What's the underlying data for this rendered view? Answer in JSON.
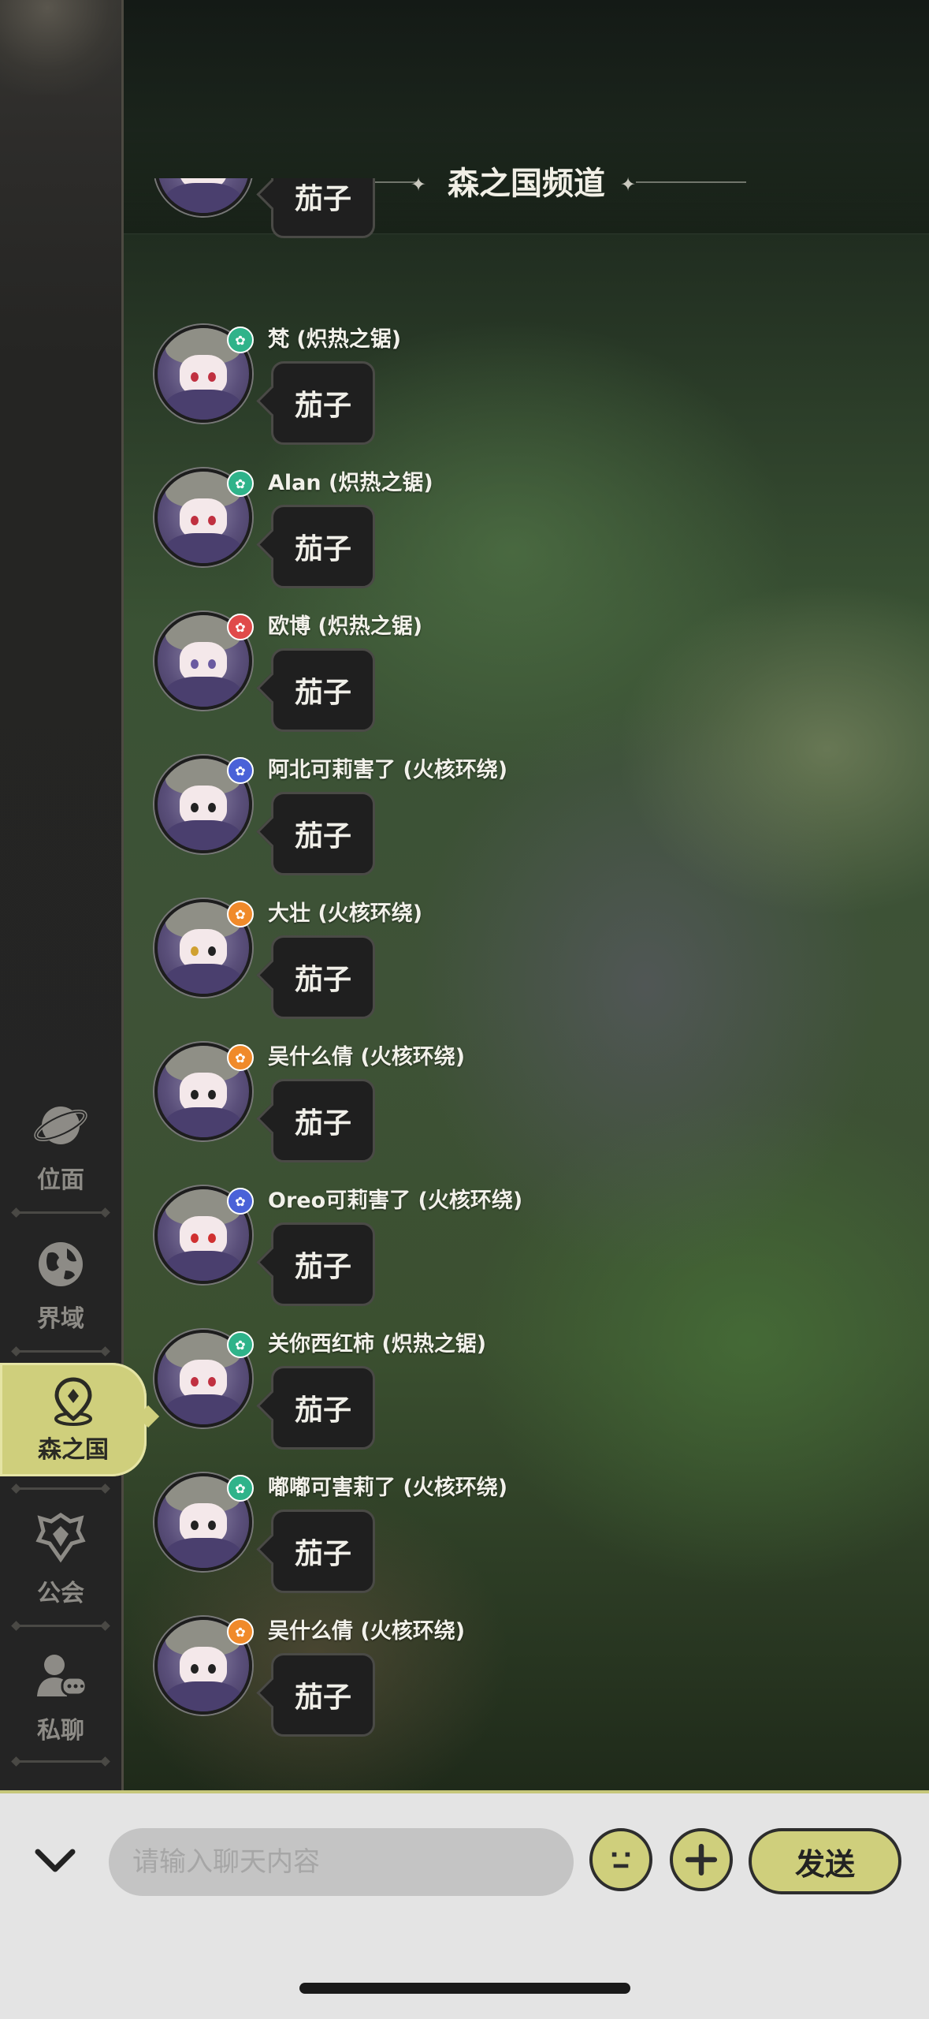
{
  "channel": {
    "title": "森之国频道"
  },
  "sidebar": {
    "items": [
      {
        "label": "位面",
        "icon": "planet-icon"
      },
      {
        "label": "界域",
        "icon": "globe-icon"
      },
      {
        "label": "森之国",
        "icon": "location-pin-icon",
        "active": true
      },
      {
        "label": "公会",
        "icon": "guild-crest-icon"
      },
      {
        "label": "私聊",
        "icon": "private-chat-icon"
      }
    ]
  },
  "messages": [
    {
      "name": "",
      "text": "茄子",
      "badge_color": "#7a7aa0"
    },
    {
      "name": "梵 (炽热之锯)",
      "text": "茄子",
      "badge_color": "#2fb38a"
    },
    {
      "name": "Alan (炽热之锯)",
      "text": "茄子",
      "badge_color": "#2fb38a"
    },
    {
      "name": "欧博 (炽热之锯)",
      "text": "茄子",
      "badge_color": "#e04a4a"
    },
    {
      "name": "阿北可莉害了 (火核环绕)",
      "text": "茄子",
      "badge_color": "#4a62d8"
    },
    {
      "name": "大壮 (火核环绕)",
      "text": "茄子",
      "badge_color": "#f08a2a"
    },
    {
      "name": "吴什么倩 (火核环绕)",
      "text": "茄子",
      "badge_color": "#f08a2a"
    },
    {
      "name": "Oreo可莉害了 (火核环绕)",
      "text": "茄子",
      "badge_color": "#4a62d8"
    },
    {
      "name": "关你西红柿 (炽热之锯)",
      "text": "茄子",
      "badge_color": "#2fb38a"
    },
    {
      "name": "嘟嘟可害莉了 (火核环绕)",
      "text": "茄子",
      "badge_color": "#2fb38a"
    },
    {
      "name": "吴什么倩 (火核环绕)",
      "text": "茄子",
      "badge_color": "#f08a2a"
    }
  ],
  "input_bar": {
    "placeholder": "请输入聊天内容",
    "send_label": "发送"
  },
  "colors": {
    "accent": "#cfcf7c",
    "sidebar_bg": "#242424",
    "bubble_bg": "#1f1f1f",
    "bottom_bar_bg": "#e4e4e4"
  }
}
